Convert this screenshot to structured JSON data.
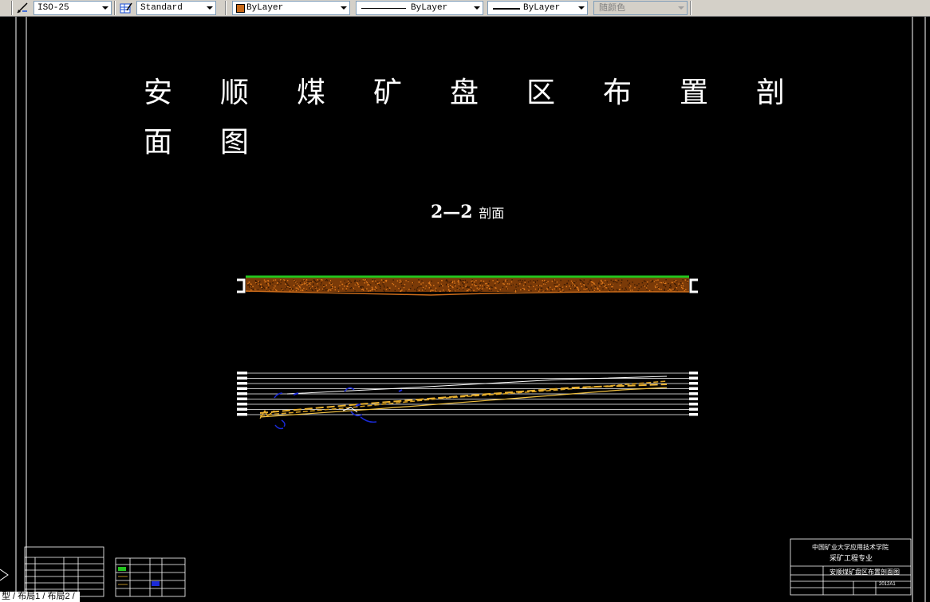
{
  "toolbar": {
    "dimstyle": "ISO-25",
    "tablestyle": "Standard",
    "color": "ByLayer",
    "linetype": "ByLayer",
    "lineweight": "ByLayer",
    "plotstyle": "随颜色",
    "color_swatch": "#c86a1a"
  },
  "drawing": {
    "title_chars": [
      "安",
      "顺",
      "煤",
      "矿",
      "盘",
      "区",
      "布",
      "置",
      "剖",
      "面",
      "图"
    ],
    "section_label": "2—2",
    "section_suffix": "剖面"
  },
  "title_block": {
    "school": "中国矿业大学应用技术学院",
    "major": "采矿工程专业",
    "drawing_name": "安顺煤矿盘区布置剖面图",
    "number": "2012A1"
  },
  "tabs": {
    "model": "型",
    "layout1": "布局1",
    "layout2": "布局2"
  },
  "colors": {
    "background": "#000000",
    "strata": "#c86a1a",
    "surface": "#22c41e",
    "drift": "#1a2ad8"
  }
}
